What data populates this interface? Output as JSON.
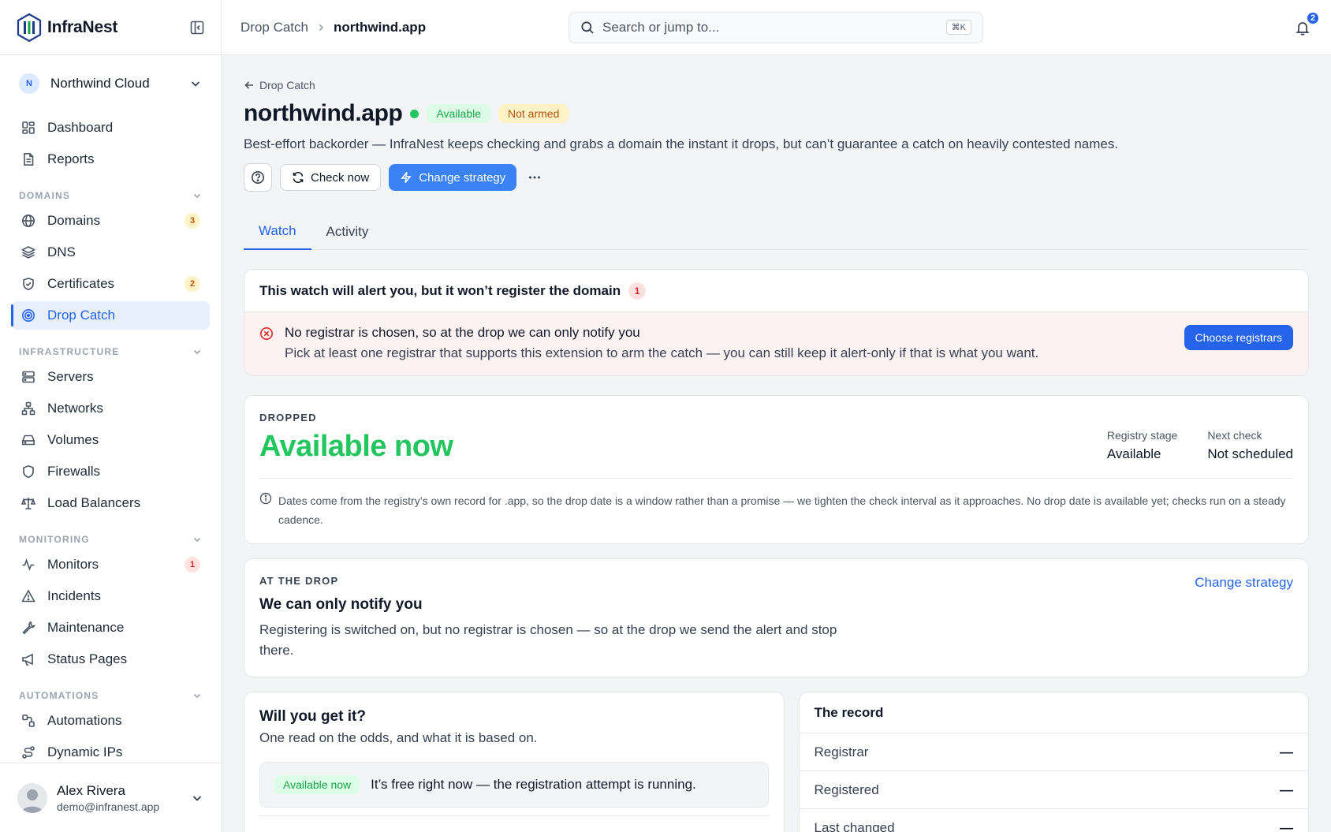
{
  "app": {
    "brand": "InfraNest",
    "org": {
      "initial": "N",
      "name": "Northwind Cloud"
    },
    "user": {
      "name": "Alex Rivera",
      "email": "demo@infranest.app"
    }
  },
  "sidebar": {
    "top_items": [
      {
        "label": "Dashboard",
        "icon": "dashboard-icon"
      },
      {
        "label": "Reports",
        "icon": "reports-icon"
      }
    ],
    "sections": [
      {
        "title": "DOMAINS",
        "items": [
          {
            "label": "Domains",
            "icon": "globe-icon",
            "badge": "3"
          },
          {
            "label": "DNS",
            "icon": "layers-icon"
          },
          {
            "label": "Certificates",
            "icon": "shield-check-icon",
            "badge": "2"
          },
          {
            "label": "Drop Catch",
            "icon": "target-icon",
            "active": true
          }
        ]
      },
      {
        "title": "INFRASTRUCTURE",
        "items": [
          {
            "label": "Servers",
            "icon": "server-icon"
          },
          {
            "label": "Networks",
            "icon": "network-icon"
          },
          {
            "label": "Volumes",
            "icon": "drive-icon"
          },
          {
            "label": "Firewalls",
            "icon": "shield-icon"
          },
          {
            "label": "Load Balancers",
            "icon": "scale-icon"
          }
        ]
      },
      {
        "title": "MONITORING",
        "items": [
          {
            "label": "Monitors",
            "icon": "pulse-icon",
            "badge": "1"
          },
          {
            "label": "Incidents",
            "icon": "warning-icon"
          },
          {
            "label": "Maintenance",
            "icon": "wrench-icon"
          },
          {
            "label": "Status Pages",
            "icon": "megaphone-icon"
          }
        ]
      },
      {
        "title": "AUTOMATIONS",
        "items": [
          {
            "label": "Automations",
            "icon": "workflow-icon"
          },
          {
            "label": "Dynamic IPs",
            "icon": "route-icon"
          }
        ]
      }
    ]
  },
  "topbar": {
    "breadcrumb_parent": "Drop Catch",
    "breadcrumb_current": "northwind.app",
    "search_placeholder": "Search or jump to...",
    "search_shortcut": "⌘K",
    "notifications_count": "2"
  },
  "page": {
    "back_label": "Drop Catch",
    "title": "northwind.app",
    "status_pill": "Available",
    "arm_pill": "Not armed",
    "subtitle": "Best-effort backorder — InfraNest keeps checking and grabs a domain the instant it drops, but can’t guarantee a catch on heavily contested names.",
    "check_now_label": "Check now",
    "change_strategy_label": "Change strategy",
    "tabs": [
      {
        "label": "Watch",
        "active": true
      },
      {
        "label": "Activity",
        "active": false
      }
    ]
  },
  "alert": {
    "heading": "This watch will alert you, but it won’t register the domain",
    "count": "1",
    "title": "No registrar is chosen, so at the drop we can only notify you",
    "description": "Pick at least one registrar that supports this extension to arm the catch — you can still keep it alert-only if that is what you want.",
    "action_label": "Choose registrars"
  },
  "drop": {
    "eyebrow": "DROPPED",
    "status": "Available now",
    "registry_stage_label": "Registry stage",
    "registry_stage_value": "Available",
    "next_check_label": "Next check",
    "next_check_value": "Not scheduled",
    "note": "Dates come from the registry’s own record for .app, so the drop date is a window rather than a promise — we tighten the check interval as it approaches. No drop date is available yet; checks run on a steady cadence."
  },
  "strategy": {
    "eyebrow": "AT THE DROP",
    "title": "We can only notify you",
    "description": "Registering is switched on, but no registrar is chosen — so at the drop we send the alert and stop there.",
    "link_label": "Change strategy"
  },
  "odds": {
    "title": "Will you get it?",
    "subtitle": "One read on the odds, and what it is based on.",
    "pill": "Available now",
    "text": "It’s free right now — the registration attempt is running."
  },
  "record": {
    "title": "The record",
    "rows": [
      {
        "label": "Registrar",
        "value": "—"
      },
      {
        "label": "Registered",
        "value": "—"
      },
      {
        "label": "Last changed",
        "value": "—"
      }
    ]
  },
  "colors": {
    "accent": "#2563eb",
    "success": "#22c55e",
    "warning": "#b45309",
    "danger": "#dc2626"
  }
}
